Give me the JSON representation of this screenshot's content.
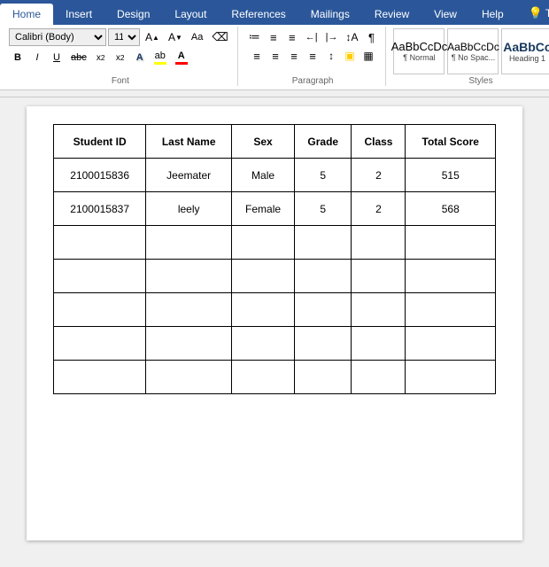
{
  "ribbon": {
    "tabs": [
      "Home",
      "Insert",
      "Design",
      "Layout",
      "References",
      "Mailings",
      "Review",
      "View",
      "Help",
      "Tell"
    ],
    "active_tab": "Home"
  },
  "toolbar": {
    "font_name": "Calibri (Body)",
    "font_size": "11",
    "styles": [
      {
        "id": "normal",
        "preview": "AaBbCcDc",
        "label": "¶ Normal"
      },
      {
        "id": "nospace",
        "preview": "AaBbCcDc",
        "label": "¶ No Spac..."
      },
      {
        "id": "heading1",
        "preview": "AaBbCc",
        "label": "Heading 1"
      }
    ],
    "buttons": {
      "bold": "B",
      "italic": "I",
      "underline": "U",
      "strikethrough": "abc",
      "subscript": "x₂",
      "superscript": "x²",
      "font_color": "A",
      "highlight": "ab",
      "clear_format": "⌫",
      "font_size_inc": "A↑",
      "font_size_dec": "A↓",
      "change_case": "Aa",
      "text_effects": "A",
      "bullets": "≡",
      "numbering": "≡",
      "multilevel": "≡",
      "decrease_indent": "←",
      "increase_indent": "→",
      "sort": "↕",
      "show_marks": "¶",
      "align_left": "≡",
      "center": "≡",
      "align_right": "≡",
      "justify": "≡",
      "line_spacing": "↕",
      "shading": "▣",
      "borders": "▦",
      "editing": "✎"
    },
    "group_labels": {
      "font": "Font",
      "paragraph": "Paragraph",
      "styles": "Styles"
    }
  },
  "table": {
    "headers": [
      "Student ID",
      "Last Name",
      "Sex",
      "Grade",
      "Class",
      "Total Score"
    ],
    "rows": [
      [
        "2100015836",
        "Jeemater",
        "Male",
        "5",
        "2",
        "515"
      ],
      [
        "2100015837",
        "leely",
        "Female",
        "5",
        "2",
        "568"
      ],
      [
        "",
        "",
        "",
        "",
        "",
        ""
      ],
      [
        "",
        "",
        "",
        "",
        "",
        ""
      ],
      [
        "",
        "",
        "",
        "",
        "",
        ""
      ],
      [
        "",
        "",
        "",
        "",
        "",
        ""
      ],
      [
        "",
        "",
        "",
        "",
        "",
        ""
      ]
    ]
  }
}
